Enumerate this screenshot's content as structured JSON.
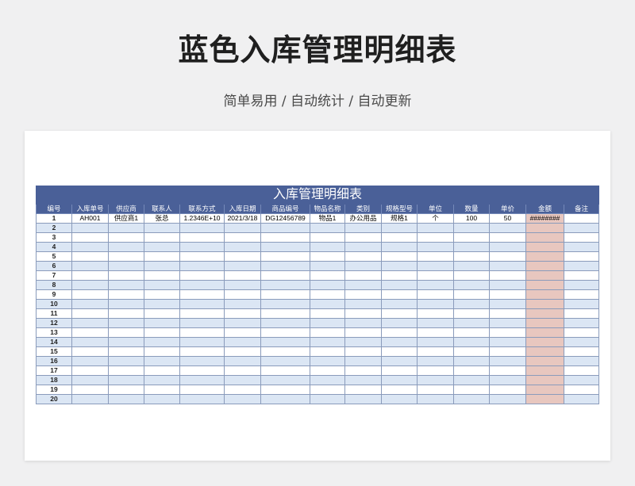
{
  "banner": {
    "title": "蓝色入库管理明细表",
    "subtitle": "简单易用 / 自动统计 / 自动更新"
  },
  "sheet": {
    "title": "入库管理明细表",
    "headers": [
      "编号",
      "入库单号",
      "供应商",
      "联系人",
      "联系方式",
      "入库日期",
      "商品编号",
      "物品名称",
      "类别",
      "规格型号",
      "单位",
      "数量",
      "单价",
      "金额",
      "备注"
    ],
    "rows": [
      [
        "1",
        "AH001",
        "供应商1",
        "张总",
        "1.2346E+10",
        "2021/3/18",
        "DG12456789",
        "物品1",
        "办公用品",
        "规格1",
        "个",
        "100",
        "50",
        "########",
        ""
      ],
      [
        "2",
        "",
        "",
        "",
        "",
        "",
        "",
        "",
        "",
        "",
        "",
        "",
        "",
        "",
        ""
      ],
      [
        "3",
        "",
        "",
        "",
        "",
        "",
        "",
        "",
        "",
        "",
        "",
        "",
        "",
        "",
        ""
      ],
      [
        "4",
        "",
        "",
        "",
        "",
        "",
        "",
        "",
        "",
        "",
        "",
        "",
        "",
        "",
        ""
      ],
      [
        "5",
        "",
        "",
        "",
        "",
        "",
        "",
        "",
        "",
        "",
        "",
        "",
        "",
        "",
        ""
      ],
      [
        "6",
        "",
        "",
        "",
        "",
        "",
        "",
        "",
        "",
        "",
        "",
        "",
        "",
        "",
        ""
      ],
      [
        "7",
        "",
        "",
        "",
        "",
        "",
        "",
        "",
        "",
        "",
        "",
        "",
        "",
        "",
        ""
      ],
      [
        "8",
        "",
        "",
        "",
        "",
        "",
        "",
        "",
        "",
        "",
        "",
        "",
        "",
        "",
        ""
      ],
      [
        "9",
        "",
        "",
        "",
        "",
        "",
        "",
        "",
        "",
        "",
        "",
        "",
        "",
        "",
        ""
      ],
      [
        "10",
        "",
        "",
        "",
        "",
        "",
        "",
        "",
        "",
        "",
        "",
        "",
        "",
        "",
        ""
      ],
      [
        "11",
        "",
        "",
        "",
        "",
        "",
        "",
        "",
        "",
        "",
        "",
        "",
        "",
        "",
        ""
      ],
      [
        "12",
        "",
        "",
        "",
        "",
        "",
        "",
        "",
        "",
        "",
        "",
        "",
        "",
        "",
        ""
      ],
      [
        "13",
        "",
        "",
        "",
        "",
        "",
        "",
        "",
        "",
        "",
        "",
        "",
        "",
        "",
        ""
      ],
      [
        "14",
        "",
        "",
        "",
        "",
        "",
        "",
        "",
        "",
        "",
        "",
        "",
        "",
        "",
        ""
      ],
      [
        "15",
        "",
        "",
        "",
        "",
        "",
        "",
        "",
        "",
        "",
        "",
        "",
        "",
        "",
        ""
      ],
      [
        "16",
        "",
        "",
        "",
        "",
        "",
        "",
        "",
        "",
        "",
        "",
        "",
        "",
        "",
        ""
      ],
      [
        "17",
        "",
        "",
        "",
        "",
        "",
        "",
        "",
        "",
        "",
        "",
        "",
        "",
        "",
        ""
      ],
      [
        "18",
        "",
        "",
        "",
        "",
        "",
        "",
        "",
        "",
        "",
        "",
        "",
        "",
        "",
        ""
      ],
      [
        "19",
        "",
        "",
        "",
        "",
        "",
        "",
        "",
        "",
        "",
        "",
        "",
        "",
        "",
        ""
      ],
      [
        "20",
        "",
        "",
        "",
        "",
        "",
        "",
        "",
        "",
        "",
        "",
        "",
        "",
        "",
        ""
      ]
    ]
  },
  "colors": {
    "header": "#4a6098",
    "row_alt": "#dbe6f4",
    "amount_column": "#e8c7bf"
  }
}
